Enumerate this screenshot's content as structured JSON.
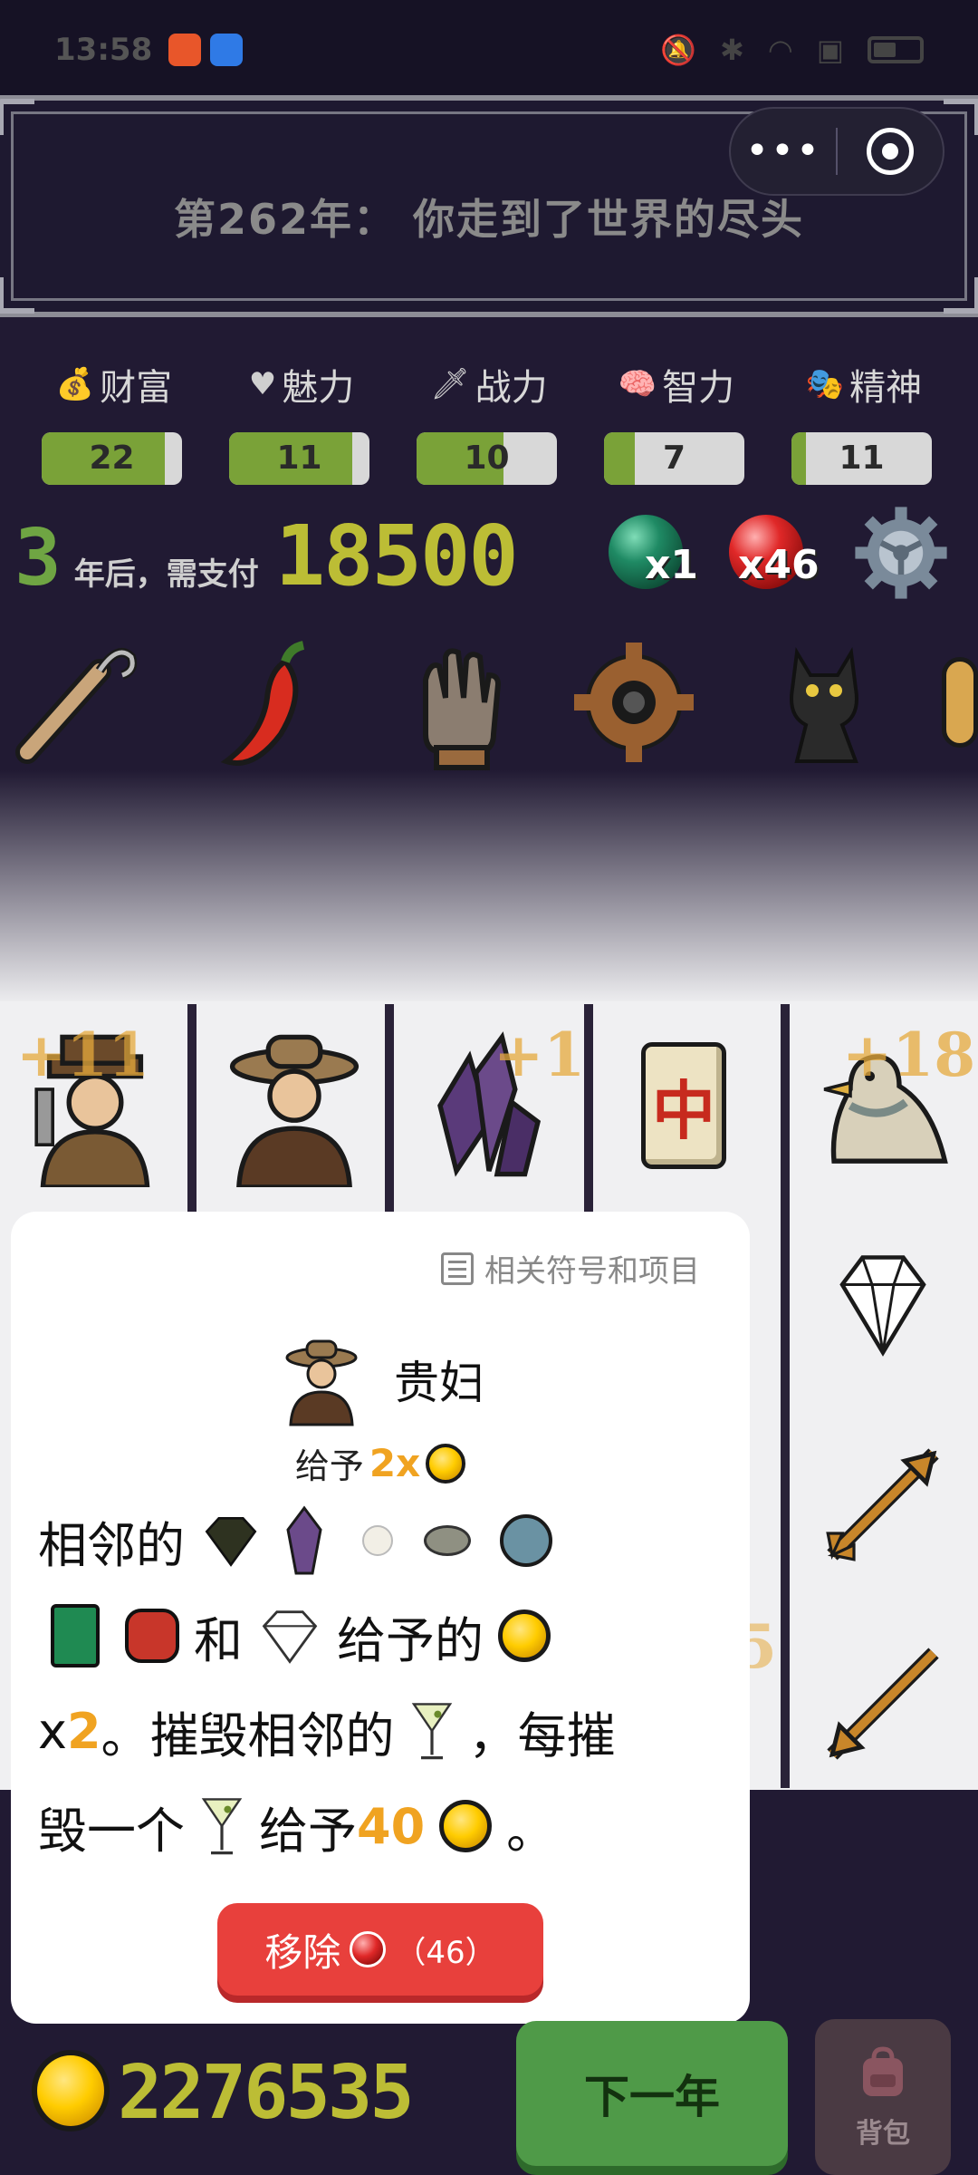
{
  "status_bar": {
    "time": "13:58"
  },
  "title": "第262年： 你走到了世界的尽头",
  "capsule": {
    "more": "•••"
  },
  "stats": [
    {
      "label": "财富",
      "icon": "money-bag-icon",
      "value": "22",
      "fill": 0.88
    },
    {
      "label": "魅力",
      "icon": "heart-icon",
      "value": "11",
      "fill": 0.88
    },
    {
      "label": "战力",
      "icon": "sword-icon",
      "value": "10",
      "fill": 0.62
    },
    {
      "label": "智力",
      "icon": "brain-icon",
      "value": "7",
      "fill": 0.22
    },
    {
      "label": "精神",
      "icon": "masks-icon",
      "value": "11",
      "fill": 0.1
    }
  ],
  "rent": {
    "years": "3",
    "text": "年后，需支付",
    "amount": "18500"
  },
  "orbs": {
    "green_count": "x1",
    "red_count": "x46"
  },
  "items": [
    "hook-icon",
    "chili-pepper-icon",
    "glove-icon",
    "gear-ring-icon",
    "black-cat-icon"
  ],
  "board": {
    "bonuses": [
      "+11",
      "+1",
      "+18",
      "5"
    ],
    "symbols_top": [
      "miner-icon",
      "lady-icon",
      "amethyst-icon",
      "mahjong-zhong-icon",
      "pigeon-icon"
    ],
    "symbols_right": [
      "diamond-icon",
      "arrow-icon",
      "arrow-down-icon"
    ],
    "mahjong_char": "中"
  },
  "popup": {
    "related": "相关符号和项目",
    "name": "贵妇",
    "sub_prefix": "给予",
    "sub_mult": "2x",
    "line1_prefix": "相邻的",
    "line2_and": "和",
    "line2_give": "给予的",
    "line3_x": "x",
    "line3_num": "2",
    "line3_rest": "。摧毁相邻的",
    "line3_comma": "，每摧",
    "line4_a": "毁一个",
    "line4_give": "给予",
    "line4_num": "40",
    "line4_end": "。",
    "remove_label": "移除",
    "remove_count": "（46）"
  },
  "bottom": {
    "money": "2276535",
    "next_year": "下一年",
    "bag": "背包"
  }
}
